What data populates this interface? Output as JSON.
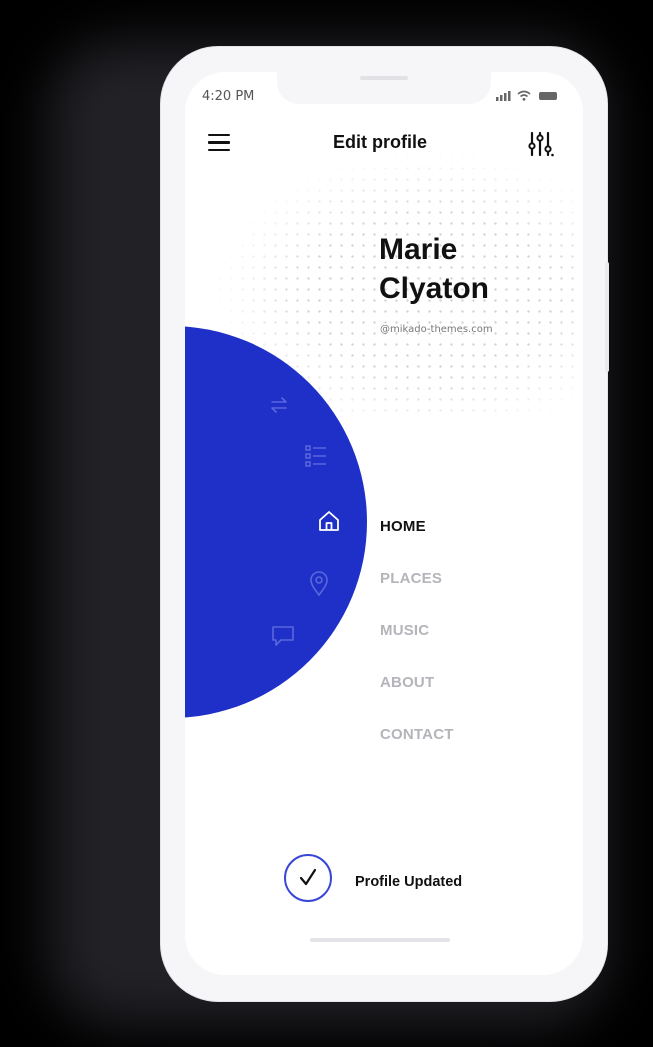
{
  "status_bar": {
    "time": "4:20 PM",
    "signal": "‧‧∣",
    "wifi": "wifi-icon",
    "battery": "battery-icon"
  },
  "header": {
    "title": "Edit profile",
    "menu_icon": "hamburger-icon",
    "settings_icon": "sliders-icon"
  },
  "profile": {
    "first_name": "Marie",
    "last_name": "Clyaton",
    "handle": "@mikado-themes.com"
  },
  "side_icons": [
    "swap-icon",
    "list-icon",
    "home-icon",
    "location-pin-icon",
    "chat-icon"
  ],
  "menu": {
    "items": [
      {
        "label": "HOME",
        "active": true
      },
      {
        "label": "PLACES",
        "active": false
      },
      {
        "label": "MUSIC",
        "active": false
      },
      {
        "label": "ABOUT",
        "active": false
      },
      {
        "label": "CONTACT",
        "active": false
      }
    ]
  },
  "toast": {
    "icon": "check-icon",
    "text": "Profile Updated"
  },
  "colors": {
    "accent": "#1f30c9",
    "check_ring": "#3a47d6",
    "inactive": "#b4b4ba",
    "text": "#111111"
  }
}
